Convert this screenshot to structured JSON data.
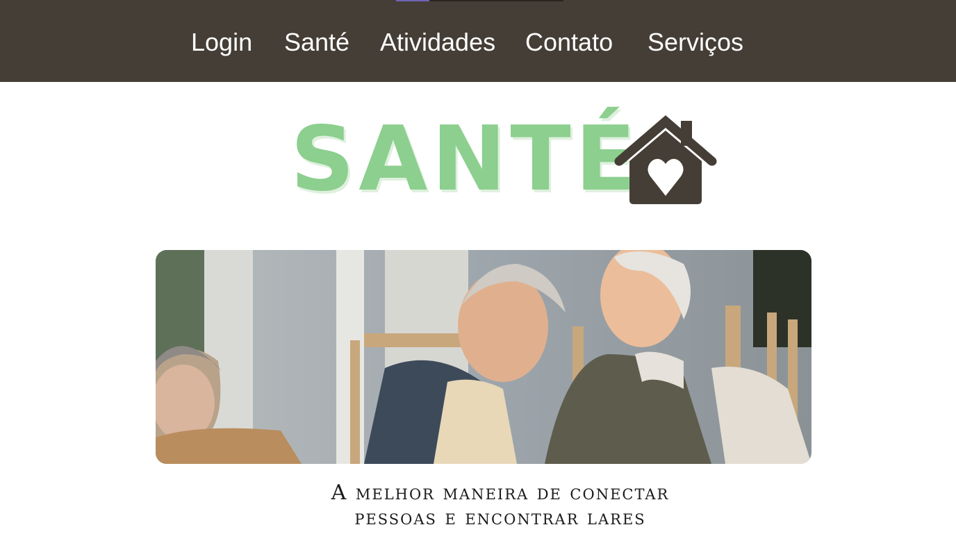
{
  "nav": {
    "items": [
      {
        "label": "Login"
      },
      {
        "label": "Santé"
      },
      {
        "label": "Atividades"
      },
      {
        "label": "Contato"
      },
      {
        "label": "Serviços"
      }
    ]
  },
  "brand": {
    "wordmark": "SANTÉ",
    "icon": "house-heart-icon",
    "wordmark_color": "#8ccf8e",
    "icon_color": "#453e36"
  },
  "hero": {
    "subject": "elderly-friends-laughing-on-porch-photo"
  },
  "tagline": {
    "line1": "A melhor maneira de conectar",
    "line2": "pessoas e encontrar lares"
  },
  "colors": {
    "header_bg": "#453e36",
    "nav_text": "#ffffff",
    "background": "#ffffff"
  }
}
